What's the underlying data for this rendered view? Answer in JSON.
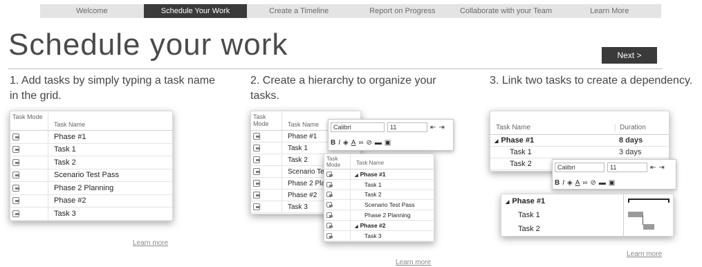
{
  "nav": {
    "tabs": [
      {
        "label": "Welcome"
      },
      {
        "label": "Schedule Your Work"
      },
      {
        "label": "Create a Timeline"
      },
      {
        "label": "Report on Progress"
      },
      {
        "label": "Collaborate with your Team"
      },
      {
        "label": "Learn More"
      }
    ],
    "active_index": 1
  },
  "page": {
    "title": "Schedule your work",
    "next_label": "Next >"
  },
  "steps": [
    {
      "text": "1.  Add tasks by simply typing a task name in the grid.",
      "link": "Learn more",
      "grid": {
        "col_mode": "Task Mode",
        "col_name": "Task Name",
        "rows": [
          "Phase #1",
          "Task 1",
          "Task 2",
          "Scenario Test Pass",
          "Phase 2 Planning",
          "Phase #2",
          "Task 3"
        ]
      }
    },
    {
      "text": "2.  Create a hierarchy to organize your tasks.",
      "link": "Learn more",
      "grid": {
        "col_mode": "Task Mode",
        "col_name": "Task Name",
        "rows": [
          "Phase #1",
          "Task 1",
          "Task 2",
          "Scenario Te",
          "Phase 2 Pla",
          "Phase #2",
          "Task 3"
        ]
      },
      "toolbar": {
        "font": "Calibri",
        "size": "11"
      },
      "outline": {
        "col_mode": "Task Mode",
        "col_name": "Task Name",
        "rows": [
          "Phase #1",
          "Task 1",
          "Task 2",
          "Scenario Test Pass",
          "Phase 2 Planning",
          "Phase #2",
          "Task 3"
        ]
      }
    },
    {
      "text": "3.  Link two tasks to create a dependency.",
      "link": "Learn more",
      "grid": {
        "col_name": "Task Name",
        "col_duration": "Duration",
        "rows": [
          {
            "name": "Phase #1",
            "duration": "8 days"
          },
          {
            "name": "Task 1",
            "duration": "3 days"
          },
          {
            "name": "Task 2",
            "duration": ""
          }
        ]
      },
      "toolbar": {
        "font": "Calibri",
        "size": "11"
      },
      "gantt": {
        "rows": [
          "Phase #1",
          "Task 1",
          "Task 2"
        ]
      }
    }
  ]
}
